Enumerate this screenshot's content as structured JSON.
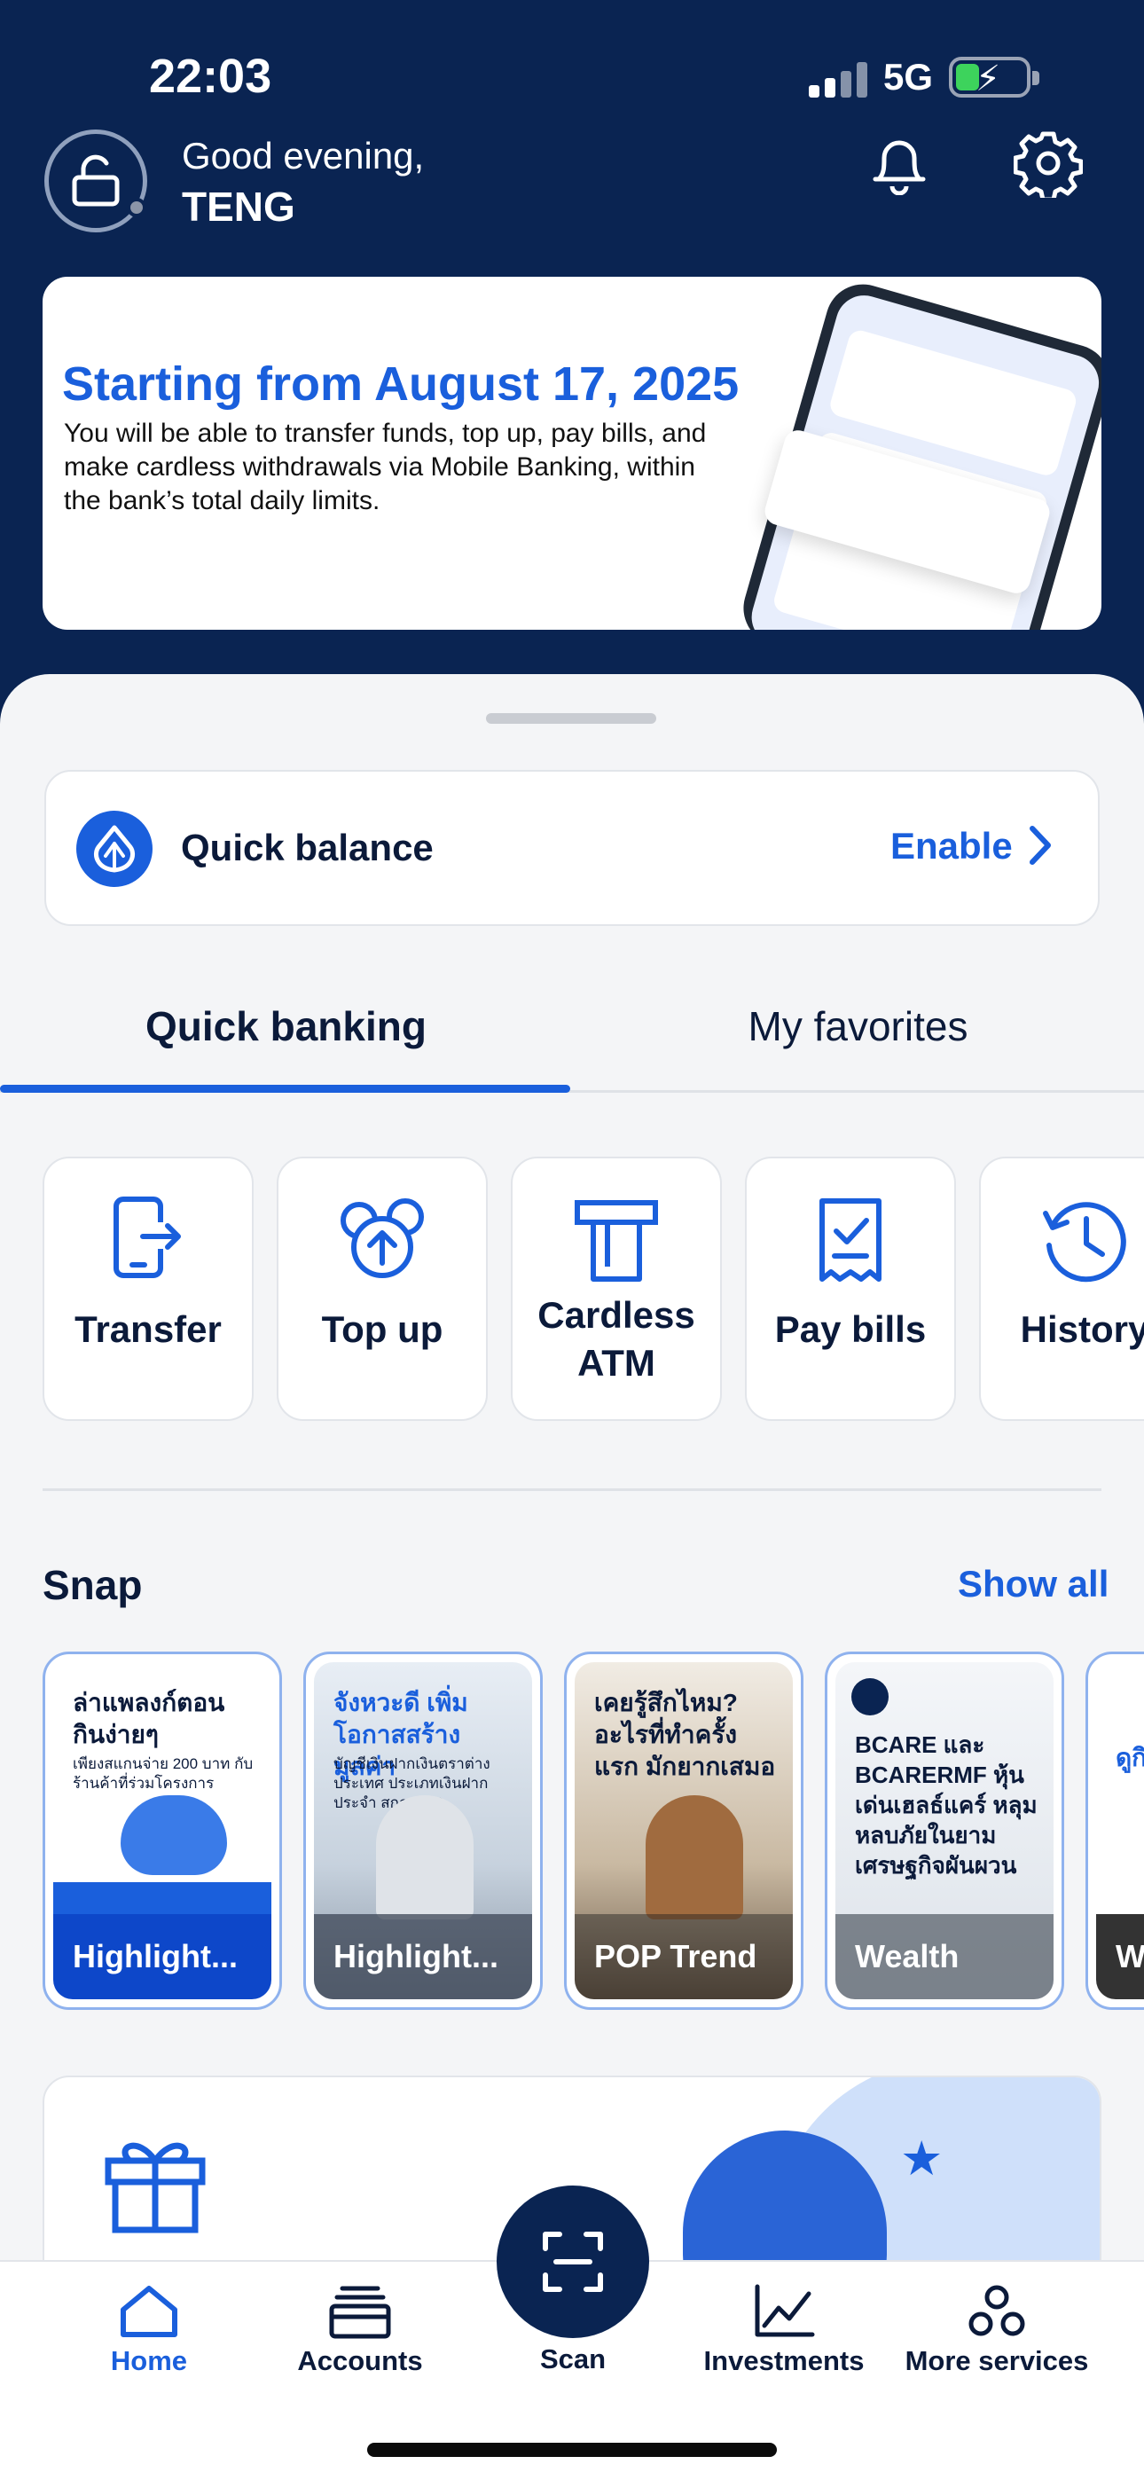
{
  "status_bar": {
    "time": "22:03",
    "network": "5G"
  },
  "header": {
    "greeting": "Good evening,",
    "user_name": "TENG"
  },
  "banner": {
    "title": "Starting from August 17, 2025",
    "text": "You will be able to transfer funds, top up, pay bills, and make cardless withdrawals via Mobile Banking, within the bank’s total daily limits."
  },
  "quick_balance": {
    "label": "Quick balance",
    "action": "Enable"
  },
  "tabs": {
    "active": "Quick banking",
    "inactive": "My favorites"
  },
  "quick_actions": [
    {
      "label": "Transfer",
      "icon": "transfer-icon"
    },
    {
      "label": "Top up",
      "icon": "top-up-icon"
    },
    {
      "label": "Cardless ATM",
      "icon": "cardless-atm-icon"
    },
    {
      "label": "Pay bills",
      "icon": "pay-bills-icon"
    },
    {
      "label": "History",
      "icon": "history-icon"
    }
  ],
  "snap": {
    "title": "Snap",
    "show_all": "Show all",
    "cards": [
      {
        "heading": "ล่าแพลงก์ตอน กินง่ายๆ",
        "sub": "เพียงสแกนจ่าย 200 บาท กับร้านค้าที่ร่วมโครงการ",
        "caption": "Highlight..."
      },
      {
        "heading": "จังหวะดี เพิ่มโอกาสสร้างมูลค่า",
        "sub": "บัญชีเงินฝากเงินตราต่างประเทศ ประเภทเงินฝากประจำ สกุล USD",
        "caption": "Highlight..."
      },
      {
        "heading": "เคยรู้สึกไหม? อะไรที่ทำครั้งแรก มักยากเสมอ",
        "sub": "",
        "caption": "POP Trend"
      },
      {
        "heading": "BCARE และ BCARERMF หุ้นเด่นเฮลธ์แคร์ หลุมหลบภัยในยาม เศรษฐกิจผันผวน",
        "sub": "",
        "caption": "Wealth"
      },
      {
        "heading": "ดูกิ หา ง่า",
        "sub": "",
        "caption": "W"
      }
    ]
  },
  "tab_bar": {
    "items": [
      {
        "label": "Home",
        "icon": "home-icon"
      },
      {
        "label": "Accounts",
        "icon": "accounts-icon"
      },
      {
        "label": "Scan",
        "icon": "scan-icon"
      },
      {
        "label": "Investments",
        "icon": "investments-icon"
      },
      {
        "label": "More services",
        "icon": "more-services-icon"
      }
    ],
    "active": "Home"
  },
  "colors": {
    "navy": "#0a2452",
    "accent": "#1a5fdc",
    "background": "#f4f5f7"
  }
}
